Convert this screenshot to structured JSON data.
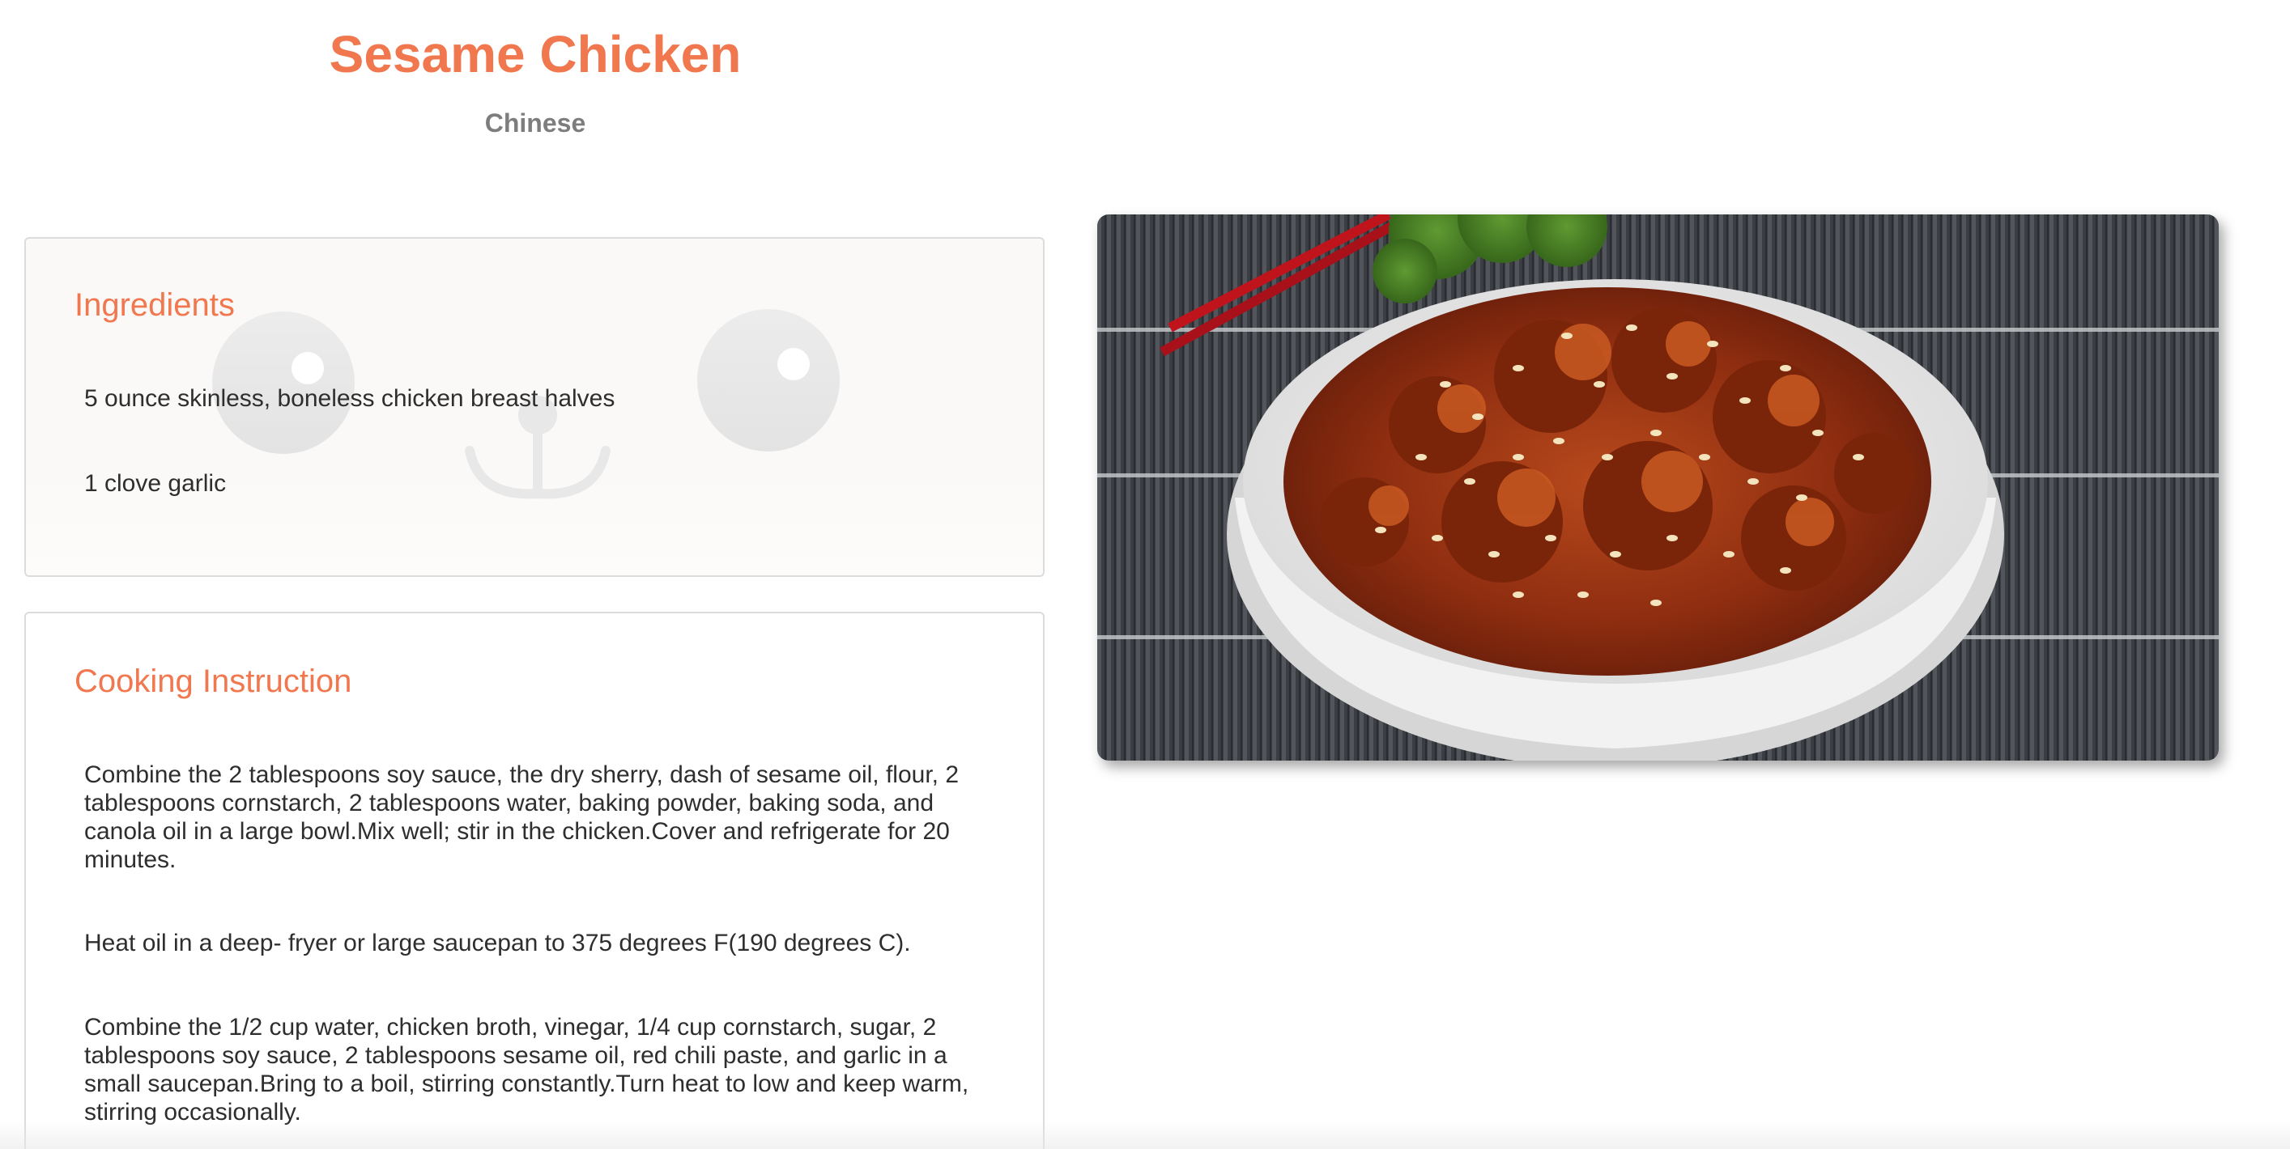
{
  "recipe": {
    "title": "Sesame Chicken",
    "cuisine": "Chinese"
  },
  "ingredients": {
    "heading": "Ingredients",
    "items": [
      "5 ounce skinless, boneless chicken breast halves",
      "1 clove garlic"
    ]
  },
  "instructions": {
    "heading": "Cooking Instruction",
    "steps": [
      "Combine the 2 tablespoons soy sauce, the dry sherry, dash of sesame oil, flour, 2 tablespoons cornstarch, 2 tablespoons water, baking powder, baking soda, and canola oil in a large bowl.Mix well; stir in the chicken.Cover and refrigerate for 20 minutes.",
      "Heat oil in a deep- fryer or large saucepan to 375 degrees F(190 degrees C).",
      "Combine the 1/2 cup water, chicken broth, vinegar, 1/4 cup cornstarch, sugar, 2 tablespoons soy sauce, 2 tablespoons sesame oil, red chili paste, and garlic in a small saucepan.Bring to a boil, stirring constantly.Turn heat to low and keep warm, stirring occasionally."
    ]
  },
  "theme": {
    "accent": "#f0774e",
    "subtle_text": "#7d7d7d",
    "body_text": "#2e2e2e",
    "card_border": "#dcdcdc"
  },
  "photo": {
    "icon": "sesame-chicken-bowl-image"
  }
}
